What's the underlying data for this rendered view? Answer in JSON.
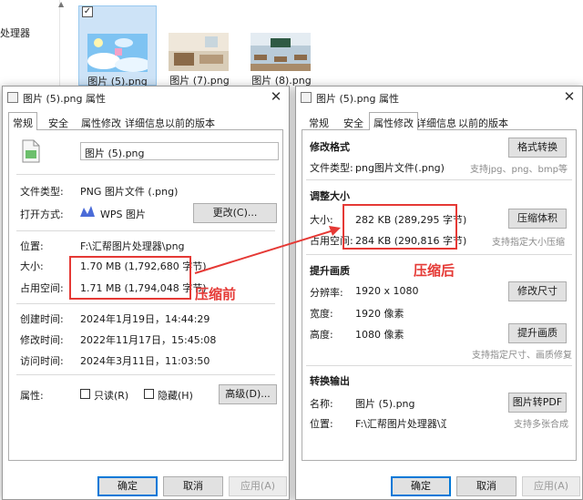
{
  "explorer": {
    "nav_text1": "",
    "nav_text2": "处理器",
    "files": [
      {
        "name": "图片 (5).png",
        "selected": true
      },
      {
        "name": "图片 (7).png",
        "selected": false
      },
      {
        "name": "图片 (8).png",
        "selected": false
      }
    ]
  },
  "left_dialog": {
    "title": "图片 (5).png 属性",
    "tabs": [
      "常规",
      "安全",
      "属性修改",
      "详细信息",
      "以前的版本"
    ],
    "filename": "图片 (5).png",
    "file_type_label": "文件类型:",
    "file_type_value": "PNG 图片文件 (.png)",
    "open_with_label": "打开方式:",
    "open_with_value": "WPS 图片",
    "change_button": "更改(C)...",
    "location_label": "位置:",
    "location_value": "F:\\汇帮图片处理器\\png",
    "size_label": "大小:",
    "size_value": "1.70 MB (1,792,680 字节)",
    "disk_label": "占用空间:",
    "disk_value": "1.71 MB (1,794,048 字节)",
    "created_label": "创建时间:",
    "created_value": "2024年1月19日，14:44:29",
    "modified_label": "修改时间:",
    "modified_value": "2022年11月17日，15:45:08",
    "accessed_label": "访问时间:",
    "accessed_value": "2024年3月11日，11:03:50",
    "attr_label": "属性:",
    "readonly_label": "只读(R)",
    "hidden_label": "隐藏(H)",
    "advanced_button": "高级(D)...",
    "ok_button": "确定",
    "cancel_button": "取消",
    "apply_button": "应用(A)"
  },
  "right_dialog": {
    "title": "图片 (5).png 属性",
    "tabs": [
      "常规",
      "安全",
      "属性修改",
      "详细信息",
      "以前的版本"
    ],
    "format_section": "修改格式",
    "file_type_label": "文件类型:",
    "file_type_value": "png图片文件(.png)",
    "format_button": "格式转换",
    "format_hint": "支持jpg、png、bmp等",
    "resize_section": "调整大小",
    "size_label": "大小:",
    "size_value": "282 KB (289,295 字节)",
    "disk_label": "占用空间:",
    "disk_value": "284 KB (290,816 字节)",
    "compress_button": "压缩体积",
    "compress_hint": "支持指定大小压缩",
    "quality_section": "提升画质",
    "resolution_label": "分辨率:",
    "resolution_value": "1920 x 1080",
    "resize_button": "修改尺寸",
    "width_label": "宽度:",
    "width_value": "1920 像素",
    "height_label": "高度:",
    "height_value": "1080 像素",
    "enhance_button": "提升画质",
    "enhance_hint": "支持指定尺寸、画质修复",
    "convert_section": "转换输出",
    "name_label": "名称:",
    "name_value": "图片 (5).png",
    "pdf_button": "图片转PDF",
    "location_label": "位置:",
    "location_value": "F:\\汇帮图片处理器\\汇帮",
    "pdf_hint": "支持多张合成",
    "ok_button": "确定",
    "cancel_button": "取消",
    "apply_button": "应用(A)"
  },
  "annotations": {
    "before": "压缩前",
    "after": "压缩后",
    "color": "#e53935"
  }
}
